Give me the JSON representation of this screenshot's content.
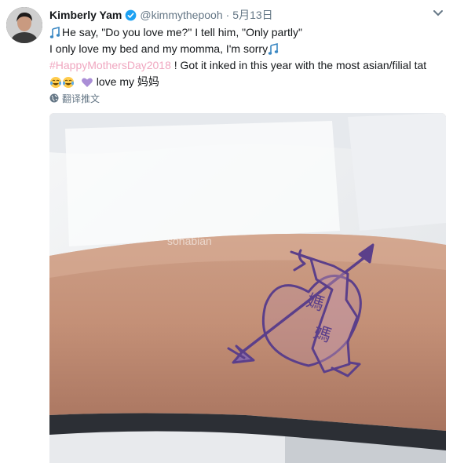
{
  "tweet": {
    "author_name": "Kimberly Yam",
    "handle": "@kimmythepooh",
    "dot": "·",
    "date": "5月13日",
    "line1": "He say, \"Do you love me?\" I tell him, \"Only partly\"",
    "line2": "I only love my bed and my momma, I'm sorry",
    "hashtag": "#HappyMothersDay2018",
    "line3_rest": " ! Got it inked in this year with the most asian/filial tat",
    "line4": " love my 妈妈",
    "translate_label": "翻译推文"
  },
  "media": {
    "tattoo_text_1": "媽",
    "tattoo_text_2": "媽",
    "watermark": "sohabian"
  },
  "icons": {
    "verified": "verified-badge-icon",
    "more": "chevron-down-icon",
    "globe": "globe-icon",
    "notes": "musical-notes-emoji",
    "laugh": "tears-of-joy-emoji",
    "heart": "purple-heart-emoji"
  },
  "colors": {
    "hashtag": "#f0a7c0",
    "verified": "#1da1f2",
    "secondary_text": "#657786",
    "tattoo_ink": "#5b3f8a"
  }
}
